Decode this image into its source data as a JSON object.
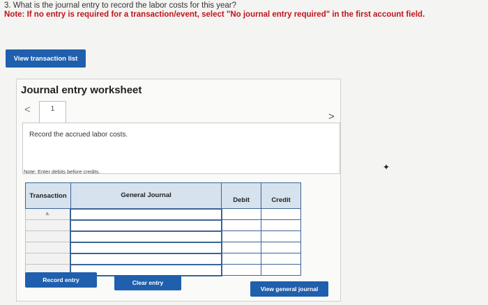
{
  "question": {
    "text": "3. What is the journal entry to record the labor costs for this year?",
    "note": "Note: If no entry is required for a transaction/event, select \"No journal entry required\" in the first account field."
  },
  "buttons": {
    "view_transaction_list": "View transaction list",
    "record_entry": "Record entry",
    "clear_entry": "Clear entry",
    "view_general_journal": "View general journal"
  },
  "worksheet": {
    "title": "Journal entry worksheet",
    "prev_icon": "chevron-left-icon",
    "next_icon": "chevron-right-icon",
    "prev_glyph": "<",
    "next_glyph": ">",
    "current_page": "1",
    "record_text": "Record the accrued labor costs.",
    "note": "Note: Enter debits before credits."
  },
  "journal_table": {
    "headers": {
      "transaction": "Transaction",
      "general_journal": "General Journal",
      "debit": "Debit",
      "credit": "Credit"
    },
    "rows": [
      {
        "transaction": "a.",
        "account": "",
        "debit": "",
        "credit": ""
      },
      {
        "transaction": "",
        "account": "",
        "debit": "",
        "credit": ""
      },
      {
        "transaction": "",
        "account": "",
        "debit": "",
        "credit": ""
      },
      {
        "transaction": "",
        "account": "",
        "debit": "",
        "credit": ""
      },
      {
        "transaction": "",
        "account": "",
        "debit": "",
        "credit": ""
      },
      {
        "transaction": "",
        "account": "",
        "debit": "",
        "credit": ""
      }
    ]
  },
  "colors": {
    "button_blue": "#1f5fad",
    "note_red": "#c0141c",
    "header_bg": "#d6e2ee",
    "border_blue": "#3a6496"
  }
}
